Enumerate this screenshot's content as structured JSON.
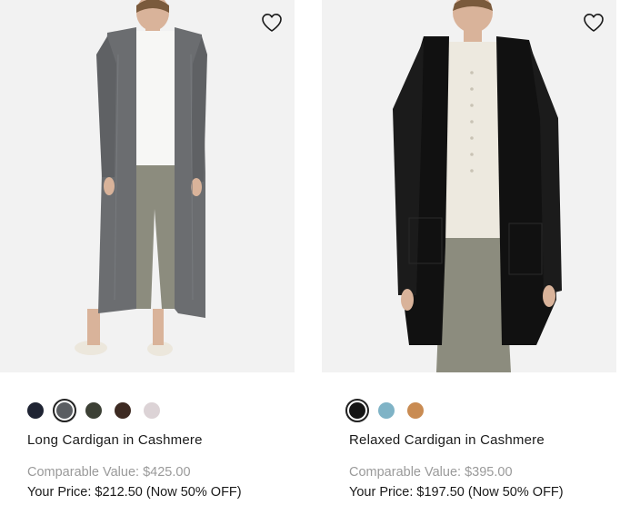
{
  "products": [
    {
      "name": "Long Cardigan in Cashmere",
      "image_alt": "model wearing long grey cashmere cardigan",
      "comparable_label": "Comparable Value:",
      "comparable_value": "$425.00",
      "price_label": "Your Price:",
      "price_value": "$212.50",
      "discount": "(Now 50% OFF)",
      "swatches": [
        {
          "color": "#1f2433",
          "name": "navy"
        },
        {
          "color": "#5a5d61",
          "name": "grey",
          "selected": true
        },
        {
          "color": "#3c4035",
          "name": "olive"
        },
        {
          "color": "#3d2a22",
          "name": "brown"
        },
        {
          "color": "#dcd3d6",
          "name": "pale-pink"
        }
      ]
    },
    {
      "name": "Relaxed Cardigan in Cashmere",
      "image_alt": "model wearing black cashmere cardigan",
      "comparable_label": "Comparable Value:",
      "comparable_value": "$395.00",
      "price_label": "Your Price:",
      "price_value": "$197.50",
      "discount": "(Now 50% OFF)",
      "swatches": [
        {
          "color": "#151515",
          "name": "black",
          "selected": true
        },
        {
          "color": "#7fb3c6",
          "name": "light-blue"
        },
        {
          "color": "#c98b52",
          "name": "camel"
        }
      ]
    }
  ]
}
